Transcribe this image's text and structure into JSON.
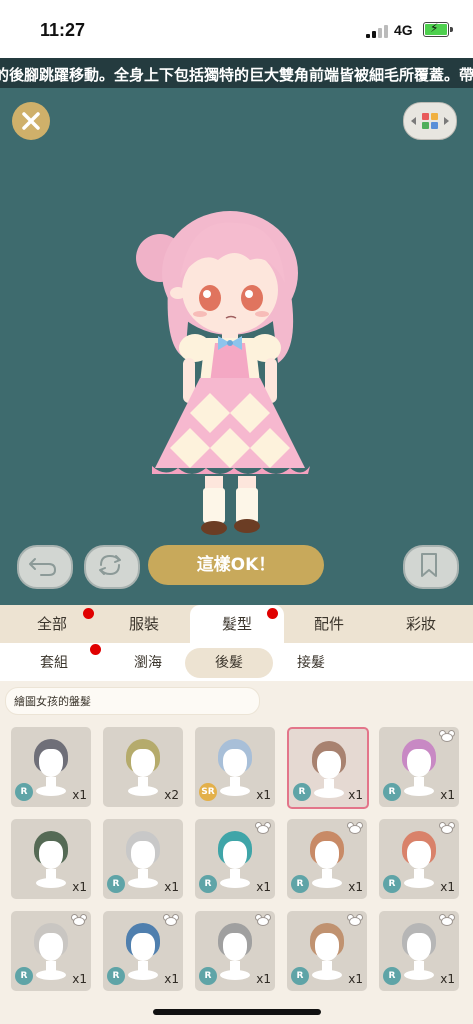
{
  "status": {
    "time": "11:27",
    "network": "4G"
  },
  "ticker": "的後腳跳躍移動。全身上下包括獨特的巨大雙角前端皆被細毛所覆蓋。帶",
  "stage": {
    "ok_label": "這樣OK！"
  },
  "category_tabs": [
    {
      "label": "全部",
      "dot": true
    },
    {
      "label": "服裝",
      "dot": false
    },
    {
      "label": "髮型",
      "dot": true,
      "active": true
    },
    {
      "label": "配件",
      "dot": false
    },
    {
      "label": "彩妝",
      "dot": false
    }
  ],
  "sub_tabs": [
    {
      "label": "套組",
      "dot": true
    },
    {
      "label": "瀏海"
    },
    {
      "label": "後髮",
      "active": true
    },
    {
      "label": "接髮"
    }
  ],
  "item_title": "繪圖女孩的盤髮",
  "items": [
    {
      "rarity": "R",
      "qty": "x1",
      "hair": "#6f6f78",
      "bear": false
    },
    {
      "rarity": "",
      "qty": "x2",
      "hair": "#b5ab6c",
      "bear": false
    },
    {
      "rarity": "SR",
      "qty": "x1",
      "hair": "#a8bfd8",
      "bear": false
    },
    {
      "rarity": "R",
      "qty": "x1",
      "hair": "#a88270",
      "bear": false,
      "selected": true
    },
    {
      "rarity": "R",
      "qty": "x1",
      "hair": "#c889c4",
      "bear": true
    },
    {
      "rarity": "",
      "qty": "x1",
      "hair": "#556a55",
      "bear": false
    },
    {
      "rarity": "R",
      "qty": "x1",
      "hair": "#c8c8c8",
      "bear": false
    },
    {
      "rarity": "R",
      "qty": "x1",
      "hair": "#3fa5a8",
      "bear": true
    },
    {
      "rarity": "R",
      "qty": "x1",
      "hair": "#c88a66",
      "bear": true
    },
    {
      "rarity": "R",
      "qty": "x1",
      "hair": "#d9826a",
      "bear": true
    },
    {
      "rarity": "R",
      "qty": "x1",
      "hair": "#c9c6c2",
      "bear": true
    },
    {
      "rarity": "R",
      "qty": "x1",
      "hair": "#4f7fae",
      "bear": true
    },
    {
      "rarity": "R",
      "qty": "x1",
      "hair": "#a0a0a0",
      "bear": true
    },
    {
      "rarity": "R",
      "qty": "x1",
      "hair": "#c09270",
      "bear": true
    },
    {
      "rarity": "R",
      "qty": "x1",
      "hair": "#b6b6b6",
      "bear": true
    }
  ],
  "colors": {
    "stage": "#3e6b6e",
    "gold": "#c8a95b",
    "tab_bg": "#ede3d2",
    "rarity_r": "#5fa4a7",
    "rarity_sr": "#e3b04a"
  }
}
